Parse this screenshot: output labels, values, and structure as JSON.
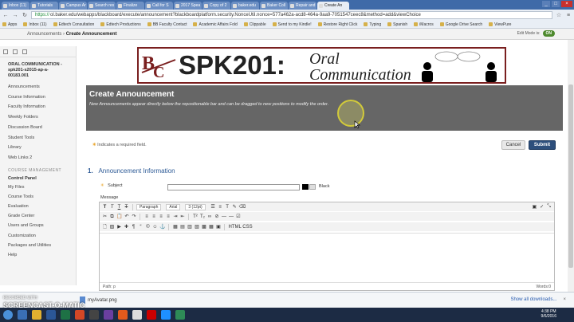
{
  "browser": {
    "tabs": [
      "Inbox (11)",
      "Tutorials",
      "Campus Ar",
      "Search res",
      "Finalize",
      "Call for S",
      "2017 Spea",
      "Copy of 2",
      "baker.edu",
      "Baker Coll",
      "Repair and",
      "Create An"
    ],
    "url_proto": "https://",
    "url": "ol.baker.edu/webapps/blackboard/execute/announcement?blackboardplatform.security.NonceUtil.nonce=577a462a-acd8-464a-9aa9-7051547ceec8&method=add&viewChoice",
    "bookmarks": [
      "Apps",
      "Inbox (11)",
      "Edtech Consultation",
      "Edtech Productions",
      "BB Faculty Contact",
      "Academic Affairs Fold",
      "Clippable",
      "Send to my Kindle!",
      "Restore Right Click",
      "Typing",
      "Spanish",
      "iMacros",
      "Google Drive Search",
      "ViewPure"
    ]
  },
  "bb": {
    "breadcrumb_root": "Announcements",
    "breadcrumb_current": "Create Announcement",
    "edit_mode_label": "Edit Mode is:",
    "edit_mode_state": "ON"
  },
  "sidebar": {
    "course_name": "ORAL COMMUNICATION - spk201-s2015-ap-a-00183.001",
    "items": [
      "Announcements",
      "Course Information",
      "Faculty Information",
      "Weekly Folders",
      "Discussion Board",
      "Student Tools",
      "Library",
      "Web Links 2"
    ],
    "section_label": "COURSE MANAGEMENT",
    "control_panel": "Control Panel",
    "cp_items": [
      "My Files",
      "Course Tools",
      "Evaluation",
      "Grade Center",
      "Users and Groups",
      "Customization",
      "Packages and Utilities",
      "Help"
    ]
  },
  "banner": {
    "logo": "BC",
    "title": "SPK201:",
    "subtitle_line1": "Oral",
    "subtitle_line2": "Communication"
  },
  "page": {
    "title": "Create Announcement",
    "description": "New Announcements appear directly below the repositionable bar and can be dragged to new positions to modify the order.",
    "required_note": "Indicates a required field.",
    "cancel_label": "Cancel",
    "submit_label": "Submit",
    "section_number": "1.",
    "section_title": "Announcement Information",
    "subject_label": "Subject",
    "subject_value": "",
    "color_name": "Black",
    "message_label": "Message"
  },
  "editor": {
    "toolbar1": [
      "T",
      "T",
      "T",
      "T"
    ],
    "paragraph": "Paragraph",
    "font": "Arial",
    "size": "3 (12pt)",
    "path_label": "Path: p",
    "words_label": "Words:0",
    "html_label": "HTML CSS"
  },
  "downloads": {
    "file": "myAvatar.png",
    "show_all": "Show all downloads...",
    "close": "×"
  },
  "watermark": {
    "line1": "RECORDED WITH",
    "line2": "SCREENCAST-O-MATIC"
  },
  "clock": {
    "time": "4:38 PM",
    "date": "9/6/2016"
  },
  "colors": {
    "bb_header_gray": "#666666",
    "submit_blue": "#2d4f7c",
    "section_blue": "#2d5a96",
    "banner_red": "#7a1f1f"
  }
}
